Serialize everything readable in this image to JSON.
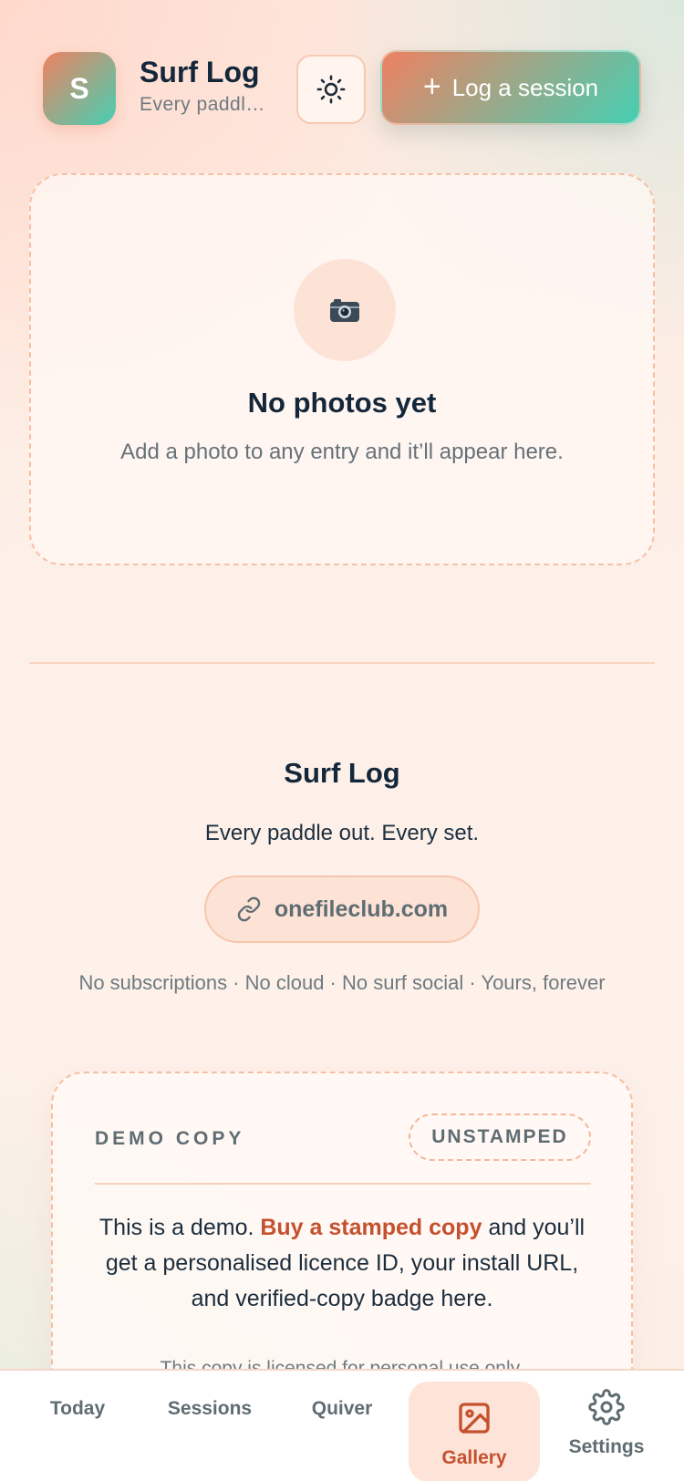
{
  "header": {
    "avatar_letter": "S",
    "title": "Surf Log",
    "subtitle": "Every paddl…",
    "theme_icon": "sun-icon",
    "log_button_label": "Log a session"
  },
  "gallery": {
    "empty_icon": "camera-emoji",
    "empty_emoji": "📷",
    "empty_title": "No photos yet",
    "empty_text": "Add a photo to any entry and it’ll appear here."
  },
  "footer": {
    "title": "Surf Log",
    "tagline": "Every paddle out. Every set.",
    "link_label": "onefileclub.com",
    "note": "No subscriptions · No cloud · No surf social · Yours, forever"
  },
  "demo": {
    "label": "DEMO COPY",
    "badge": "UNSTAMPED",
    "text_before": "This is a demo. ",
    "text_link": "Buy a stamped copy",
    "text_after": " and you’ll get a personalised licence ID, your install URL, and verified-copy badge here.",
    "fine_print": "This copy is licensed for personal use only."
  },
  "nav": {
    "items": [
      {
        "label": "Today",
        "active": false
      },
      {
        "label": "Sessions",
        "active": false
      },
      {
        "label": "Quiver",
        "active": false
      },
      {
        "label": "Gallery",
        "active": true,
        "icon": "image-icon"
      },
      {
        "label": "Settings",
        "active": false,
        "icon": "gear-icon"
      }
    ]
  },
  "colors": {
    "accent_orange": "#ee8161",
    "accent_teal": "#44cfb2",
    "active_text": "#c4512e"
  }
}
